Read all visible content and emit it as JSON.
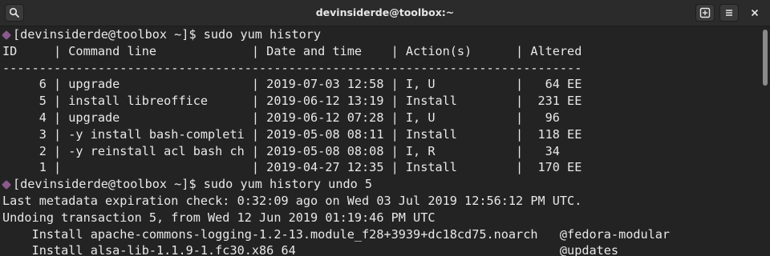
{
  "window": {
    "title": "devinsiderde@toolbox:~"
  },
  "icons": {
    "search": "search-icon",
    "new_tab": "new-tab-icon",
    "menu": "hamburger-menu-icon",
    "close": "close-icon",
    "prompt_bullet": "hexagon-prompt-icon"
  },
  "colors": {
    "background": "#232323",
    "titlebar": "#2b2b2b",
    "text": "#e8e8e8",
    "prompt_bullet": "#8a5a8c"
  },
  "terminal": {
    "lines": [
      {
        "prompt": true,
        "text": "[devinsiderde@toolbox ~]$ sudo yum history"
      },
      {
        "prompt": false,
        "text": "ID     | Command line             | Date and time    | Action(s)      | Altered"
      },
      {
        "prompt": false,
        "text": "-------------------------------------------------------------------------------"
      },
      {
        "prompt": false,
        "text": "     6 | upgrade                  | 2019-07-03 12:58 | I, U           |   64 EE"
      },
      {
        "prompt": false,
        "text": "     5 | install libreoffice      | 2019-06-12 13:19 | Install        |  231 EE"
      },
      {
        "prompt": false,
        "text": "     4 | upgrade                  | 2019-06-12 07:28 | I, U           |   96"
      },
      {
        "prompt": false,
        "text": "     3 | -y install bash-completi | 2019-05-08 08:11 | Install        |  118 EE"
      },
      {
        "prompt": false,
        "text": "     2 | -y reinstall acl bash ch | 2019-05-08 08:08 | I, R           |   34"
      },
      {
        "prompt": false,
        "text": "     1 |                          | 2019-04-27 12:35 | Install        |  170 EE"
      },
      {
        "prompt": true,
        "text": "[devinsiderde@toolbox ~]$ sudo yum history undo 5"
      },
      {
        "prompt": false,
        "text": "Last metadata expiration check: 0:32:09 ago on Wed 03 Jul 2019 12:56:12 PM UTC."
      },
      {
        "prompt": false,
        "text": "Undoing transaction 5, from Wed 12 Jun 2019 01:19:46 PM UTC"
      },
      {
        "prompt": false,
        "text": "    Install apache-commons-logging-1.2-13.module_f28+3939+dc18cd75.noarch   @fedora-modular"
      },
      {
        "prompt": false,
        "text": "    Install alsa-lib-1.1.9-1.fc30.x86_64                                    @updates"
      }
    ]
  }
}
